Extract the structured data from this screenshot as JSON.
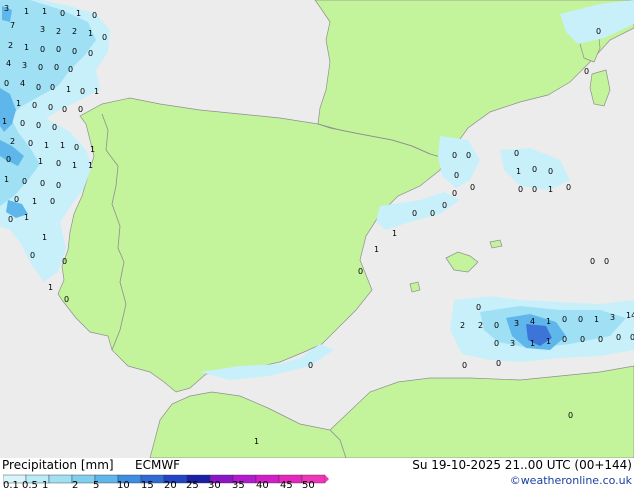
{
  "map": {
    "region": "Iberian Peninsula",
    "colors": {
      "sea": "#ececec",
      "land": "#c3f39b",
      "border": "#8f8f8f",
      "precip_light": "#c8f0fa",
      "precip_mid": "#9fe0f5",
      "precip_heavy": "#5eb6ea",
      "precip_core": "#3c74d8"
    },
    "precip_labels": [
      "3",
      "1",
      "1",
      "0",
      "1",
      "0",
      "7",
      "3",
      "2",
      "2",
      "1",
      "0",
      "2",
      "1",
      "0",
      "0",
      "0",
      "0",
      "4",
      "3",
      "0",
      "0",
      "0",
      "0",
      "4",
      "0",
      "0",
      "1",
      "0",
      "1",
      "1",
      "0",
      "0",
      "0",
      "0",
      "1",
      "0",
      "0",
      "0",
      "2",
      "0",
      "1",
      "1",
      "0",
      "1",
      "0",
      "1",
      "0",
      "1",
      "1",
      "1",
      "0",
      "0",
      "0",
      "0",
      "1",
      "0",
      "0",
      "1",
      "1",
      "0",
      "0",
      "1",
      "0",
      "0",
      "0",
      "0",
      "0",
      "0",
      "0",
      "1",
      "0",
      "0",
      "0",
      "0",
      "1",
      "0",
      "0",
      "0",
      "0",
      "1",
      "1",
      "0",
      "0",
      "2",
      "2",
      "0",
      "3",
      "4",
      "1",
      "0",
      "0",
      "1",
      "3",
      "14",
      "0",
      "3",
      "1",
      "1",
      "0",
      "0",
      "0",
      "0",
      "0",
      "0",
      "0",
      "0",
      "1",
      "0",
      "0",
      "0",
      "0",
      "0"
    ]
  },
  "footer": {
    "title": "Precipitation [mm]",
    "model": "ECMWF",
    "datetime": "Su 19-10-2025 21..00 UTC (00+144)",
    "credit": "©weatheronline.co.uk",
    "scale_ticks": [
      "0.1",
      "0.5",
      "1",
      "2",
      "5",
      "10",
      "15",
      "20",
      "25",
      "30",
      "35",
      "40",
      "45",
      "50"
    ],
    "scale_colors": [
      "#d8f5fb",
      "#b8ecf8",
      "#9fe0f5",
      "#7fd0f0",
      "#5eb6ea",
      "#3c8ee0",
      "#2f6ad6",
      "#2444c8",
      "#1a20a8",
      "#8a16c8",
      "#b41ad0",
      "#d21ec8",
      "#e627bd",
      "#f036b8"
    ]
  }
}
